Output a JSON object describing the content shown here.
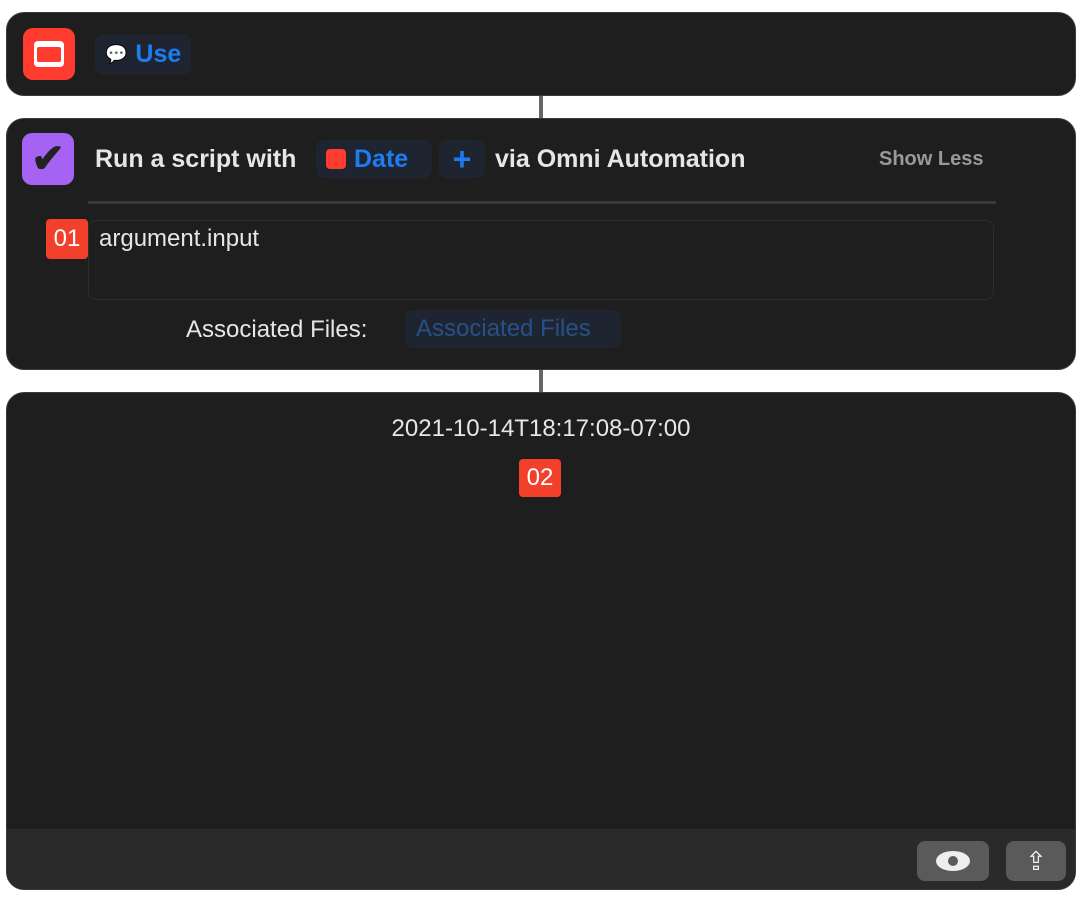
{
  "use_action": {
    "variable_label": "Use",
    "icon": "calendar-icon",
    "chip_icon": "message-bubble-icon"
  },
  "script_action": {
    "prefix": "Run a script with",
    "date_token": "Date",
    "suffix": "via Omni Automation",
    "show_less": "Show Less",
    "code": "argument.input",
    "files_label": "Associated Files:",
    "files_placeholder": "Associated Files",
    "icon": "omnifocus-check-icon"
  },
  "badges": {
    "first": "01",
    "second": "02"
  },
  "result": {
    "text": "2021-10-14T18:17:08-07:00"
  },
  "footer": {
    "preview_icon": "eye-icon",
    "share_icon": "share-icon"
  },
  "colors": {
    "accent": "#1e7cf2",
    "badge": "#f2402a",
    "calendar": "#ff3b30",
    "omni": "#a463f2"
  }
}
